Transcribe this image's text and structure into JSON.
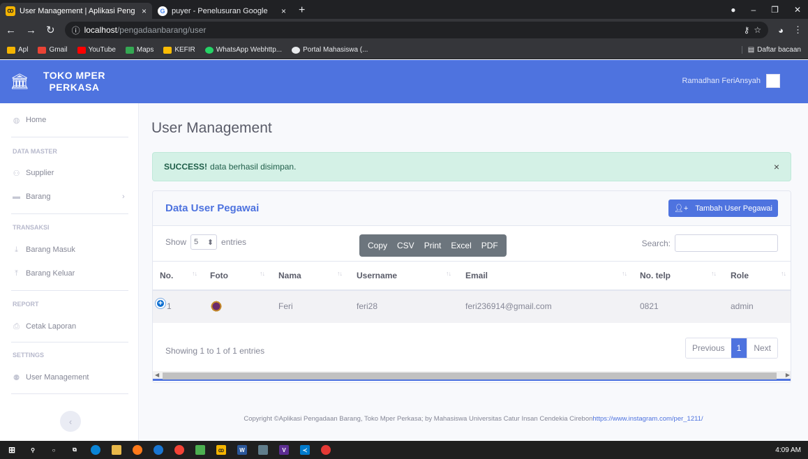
{
  "browser": {
    "tabs": [
      {
        "title": "User Management | Aplikasi Peng",
        "close": "×",
        "favicon": "app-icon",
        "active": true
      },
      {
        "title": "puyer - Penelusuran Google",
        "close": "×",
        "favicon": "google-icon",
        "active": false
      }
    ],
    "new_tab": "+",
    "address": {
      "host": "localhost",
      "path": "/pengadaanbarang/user"
    },
    "bookmarks": [
      {
        "label": "Apl",
        "icon": "apps-icon",
        "color": "#f4b400"
      },
      {
        "label": "Gmail",
        "icon": "gmail-icon",
        "color": "#ea4335"
      },
      {
        "label": "YouTube",
        "icon": "youtube-icon",
        "color": "#ff0000"
      },
      {
        "label": "Maps",
        "icon": "maps-icon",
        "color": "#34a853"
      },
      {
        "label": "KEFIR",
        "icon": "kefir-icon",
        "color": "#fbbc05"
      },
      {
        "label": "WhatsApp Webhttp...",
        "icon": "whatsapp-icon",
        "color": "#25d366"
      },
      {
        "label": "Portal Mahasiswa (...",
        "icon": "globe-icon",
        "color": "#e8eaed"
      }
    ],
    "reading_list": "Daftar bacaan"
  },
  "app": {
    "brand_line1": "TOKO MPER",
    "brand_line2": "PERKASA",
    "user_name": "Ramadhan FeriAnsyah",
    "accent": "#4e73df"
  },
  "sidebar": {
    "home": "Home",
    "section_master": "DATA MASTER",
    "supplier": "Supplier",
    "barang": "Barang",
    "section_transaksi": "TRANSAKSI",
    "barang_masuk": "Barang Masuk",
    "barang_keluar": "Barang Keluar",
    "section_report": "REPORT",
    "cetak_laporan": "Cetak Laporan",
    "section_settings": "SETTINGS",
    "user_management": "User Management",
    "collapse": "‹"
  },
  "main": {
    "page_title": "User Management",
    "alert_strong": "SUCCESS!",
    "alert_text": "data berhasil disimpan.",
    "alert_close": "×",
    "card_title": "Data User Pegawai",
    "add_button": "Tambah User Pegawai",
    "show_label": "Show",
    "entries_value": "5",
    "entries_label": "entries",
    "export_buttons": [
      "Copy",
      "CSV",
      "Print",
      "Excel",
      "PDF"
    ],
    "search_label": "Search:",
    "columns": [
      "No.",
      "Foto",
      "Nama",
      "Username",
      "Email",
      "No. telp",
      "Role"
    ],
    "rows": [
      {
        "no": "1",
        "nama": "Feri",
        "username": "feri28",
        "email": "feri236914@gmail.com",
        "telp": "0821",
        "role": "admin"
      }
    ],
    "info": "Showing 1 to 1 of 1 entries",
    "pager": {
      "prev": "Previous",
      "current": "1",
      "next": "Next"
    }
  },
  "footer": {
    "text": "Copyright ©Aplikasi Pengadaan Barang, Toko Mper Perkasa; by Mahasiswa Universitas Catur Insan Cendekia Cirebon",
    "link": "https://www.instagram.com/per_1211/"
  },
  "taskbar": {
    "clock": "4:09 AM"
  }
}
